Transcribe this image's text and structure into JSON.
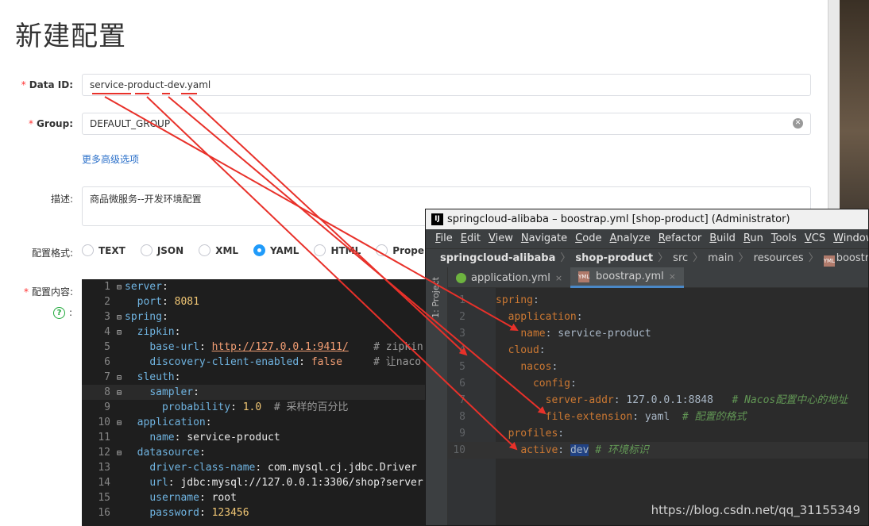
{
  "form": {
    "title": "新建配置",
    "data_id_label": "Data ID:",
    "data_id_value": "service-product-dev.yaml",
    "group_label": "Group:",
    "group_value": "DEFAULT_GROUP",
    "advanced_link": "更多高级选项",
    "desc_label": "描述:",
    "desc_value": "商品微服务--开发环境配置",
    "format_label": "配置格式:",
    "formats": [
      "TEXT",
      "JSON",
      "XML",
      "YAML",
      "HTML",
      "Properties"
    ],
    "selected_format": "YAML",
    "content_label": "配置内容:",
    "help_colon": ":",
    "required_mark": "*"
  },
  "editor_lines": [
    {
      "no": "1",
      "fold": "⊟",
      "text": [
        [
          "k",
          "server"
        ],
        [
          "p",
          ":"
        ]
      ]
    },
    {
      "no": "2",
      "fold": "",
      "text": [
        [
          "p",
          "  "
        ],
        [
          "k",
          "port"
        ],
        [
          "p",
          ": "
        ],
        [
          "n",
          "8081"
        ]
      ]
    },
    {
      "no": "3",
      "fold": "⊟",
      "text": [
        [
          "k",
          "spring"
        ],
        [
          "p",
          ":"
        ]
      ]
    },
    {
      "no": "4",
      "fold": "⊟",
      "text": [
        [
          "p",
          "  "
        ],
        [
          "k",
          "zipkin"
        ],
        [
          "p",
          ":"
        ]
      ]
    },
    {
      "no": "5",
      "fold": "",
      "text": [
        [
          "p",
          "    "
        ],
        [
          "k",
          "base-url"
        ],
        [
          "p",
          ": "
        ],
        [
          "u",
          "http://127.0.0.1:9411/"
        ],
        [
          "p",
          "    "
        ],
        [
          "c",
          "# zipkin"
        ]
      ]
    },
    {
      "no": "6",
      "fold": "",
      "text": [
        [
          "p",
          "    "
        ],
        [
          "k",
          "discovery-client-enabled"
        ],
        [
          "p",
          ": "
        ],
        [
          "b",
          "false"
        ],
        [
          "p",
          "     "
        ],
        [
          "c",
          "# 让naco"
        ]
      ]
    },
    {
      "no": "7",
      "fold": "⊟",
      "text": [
        [
          "p",
          "  "
        ],
        [
          "k",
          "sleuth"
        ],
        [
          "p",
          ":"
        ]
      ]
    },
    {
      "no": "8",
      "fold": "⊟",
      "text": [
        [
          "p",
          "    "
        ],
        [
          "k",
          "sampler"
        ],
        [
          "p",
          ":"
        ]
      ]
    },
    {
      "no": "9",
      "fold": "",
      "text": [
        [
          "p",
          "      "
        ],
        [
          "k",
          "probability"
        ],
        [
          "p",
          ": "
        ],
        [
          "n",
          "1.0"
        ],
        [
          "p",
          "  "
        ],
        [
          "c",
          "# 采样的百分比"
        ]
      ]
    },
    {
      "no": "10",
      "fold": "⊟",
      "text": [
        [
          "p",
          "  "
        ],
        [
          "k",
          "application"
        ],
        [
          "p",
          ":"
        ]
      ]
    },
    {
      "no": "11",
      "fold": "",
      "text": [
        [
          "p",
          "    "
        ],
        [
          "k",
          "name"
        ],
        [
          "p",
          ": "
        ],
        [
          "v",
          "service-product"
        ]
      ]
    },
    {
      "no": "12",
      "fold": "⊟",
      "text": [
        [
          "p",
          "  "
        ],
        [
          "k",
          "datasource"
        ],
        [
          "p",
          ":"
        ]
      ]
    },
    {
      "no": "13",
      "fold": "",
      "text": [
        [
          "p",
          "    "
        ],
        [
          "k",
          "driver-class-name"
        ],
        [
          "p",
          ": "
        ],
        [
          "v",
          "com.mysql.cj.jdbc.Driver"
        ]
      ]
    },
    {
      "no": "14",
      "fold": "",
      "text": [
        [
          "p",
          "    "
        ],
        [
          "k",
          "url"
        ],
        [
          "p",
          ": "
        ],
        [
          "v",
          "jdbc:mysql://127.0.0.1:3306/shop?server"
        ]
      ]
    },
    {
      "no": "15",
      "fold": "",
      "text": [
        [
          "p",
          "    "
        ],
        [
          "k",
          "username"
        ],
        [
          "p",
          ": "
        ],
        [
          "v",
          "root"
        ]
      ]
    },
    {
      "no": "16",
      "fold": "",
      "text": [
        [
          "p",
          "    "
        ],
        [
          "k",
          "password"
        ],
        [
          "p",
          ": "
        ],
        [
          "n",
          "123456"
        ]
      ]
    }
  ],
  "idea": {
    "title": "springcloud-alibaba – boostrap.yml [shop-product] (Administrator)",
    "logo": "IJ",
    "menu": [
      "File",
      "Edit",
      "View",
      "Navigate",
      "Code",
      "Analyze",
      "Refactor",
      "Build",
      "Run",
      "Tools",
      "VCS",
      "Window"
    ],
    "breadcrumb": [
      "springcloud-alibaba",
      "shop-product",
      "src",
      "main",
      "resources",
      "boostrap.yml"
    ],
    "breadcrumb_sep": "〉",
    "yml_icon": "YML",
    "project_tab": "1: Project",
    "tabs": [
      {
        "label": "application.yml",
        "active": false
      },
      {
        "label": "boostrap.yml",
        "active": true
      }
    ],
    "tab_close": "×",
    "lines": [
      {
        "no": "1",
        "text": [
          [
            "ik",
            "spring"
          ],
          [
            "iv",
            ":"
          ]
        ]
      },
      {
        "no": "2",
        "text": [
          [
            "iv",
            "  "
          ],
          [
            "ik",
            "application"
          ],
          [
            "iv",
            ":"
          ]
        ]
      },
      {
        "no": "3",
        "text": [
          [
            "iv",
            "    "
          ],
          [
            "ik",
            "name"
          ],
          [
            "iv",
            ": service-product"
          ]
        ]
      },
      {
        "no": "4",
        "text": [
          [
            "iv",
            "  "
          ],
          [
            "ik",
            "cloud"
          ],
          [
            "iv",
            ":"
          ]
        ]
      },
      {
        "no": "5",
        "text": [
          [
            "iv",
            "    "
          ],
          [
            "ik",
            "nacos"
          ],
          [
            "iv",
            ":"
          ]
        ]
      },
      {
        "no": "6",
        "text": [
          [
            "iv",
            "      "
          ],
          [
            "ik",
            "config"
          ],
          [
            "iv",
            ":"
          ]
        ]
      },
      {
        "no": "7",
        "text": [
          [
            "iv",
            "        "
          ],
          [
            "ik",
            "server-addr"
          ],
          [
            "iv",
            ": 127.0.0.1:8848   "
          ],
          [
            "ic",
            "# Nacos配置中心的地址"
          ]
        ]
      },
      {
        "no": "8",
        "text": [
          [
            "iv",
            "        "
          ],
          [
            "ik",
            "file-extension"
          ],
          [
            "iv",
            ": yaml  "
          ],
          [
            "ic",
            "# 配置的格式"
          ]
        ]
      },
      {
        "no": "9",
        "text": [
          [
            "iv",
            "  "
          ],
          [
            "ik",
            "profiles"
          ],
          [
            "iv",
            ":"
          ]
        ]
      },
      {
        "no": "10",
        "text": [
          [
            "iv",
            "    "
          ],
          [
            "ik",
            "active"
          ],
          [
            "iv",
            ": "
          ],
          [
            "isel",
            "dev"
          ],
          [
            "iv",
            " "
          ],
          [
            "ic",
            "# 环境标识"
          ]
        ]
      }
    ]
  },
  "watermark": "https://blog.csdn.net/qq_31155349",
  "colors": {
    "accent": "#209bfa",
    "arrow": "#e8312a",
    "link": "#2a6fc9"
  }
}
